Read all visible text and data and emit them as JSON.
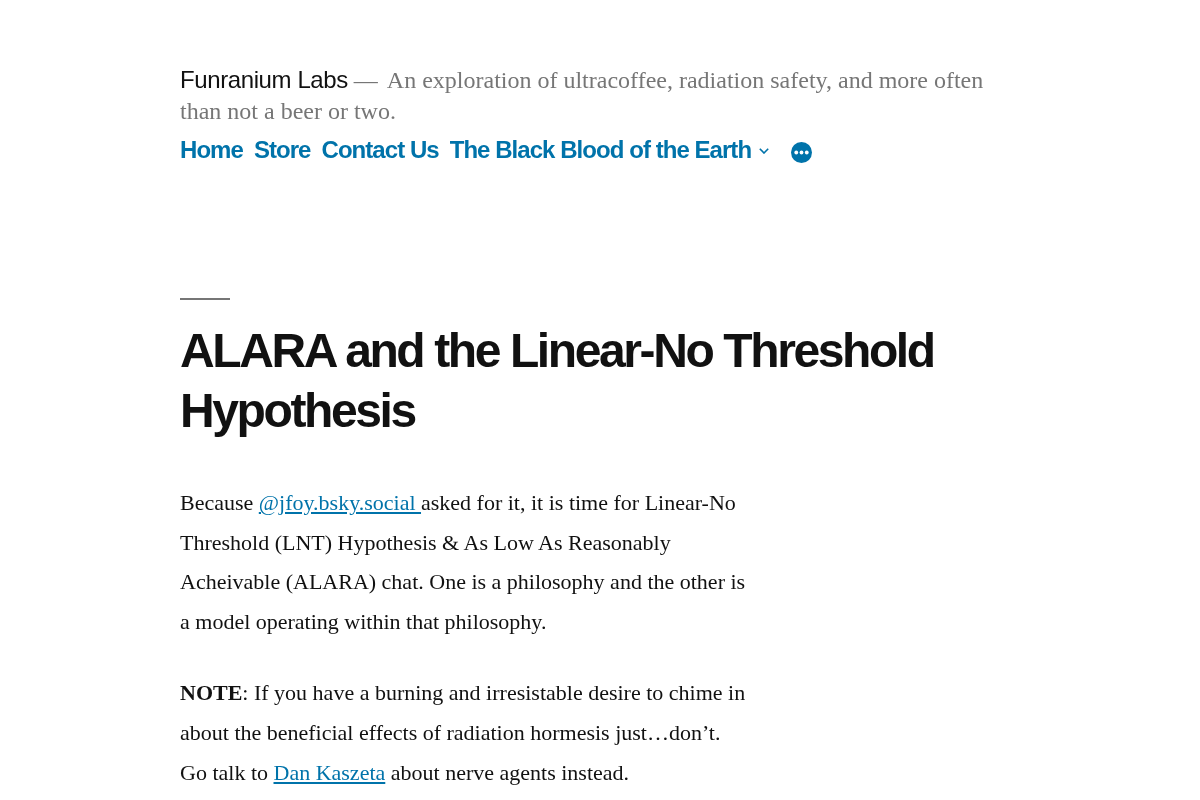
{
  "site": {
    "title": "Funranium Labs",
    "separator": "—",
    "tagline": "An exploration of ultracoffee, radiation safety, and more often than not a beer or two."
  },
  "nav": {
    "items": [
      {
        "label": "Home",
        "has_submenu": false
      },
      {
        "label": "Store",
        "has_submenu": false
      },
      {
        "label": "Contact Us",
        "has_submenu": false
      },
      {
        "label": "The Black Blood of the Earth",
        "has_submenu": true
      }
    ]
  },
  "article": {
    "title": "ALARA and the Linear-No Threshold Hypothesis",
    "paragraphs": [
      [
        {
          "kind": "text",
          "text": "Because "
        },
        {
          "kind": "link",
          "text": "@jfoy.bsky.social "
        },
        {
          "kind": "text",
          "text": "asked for it, it is time for Linear-No Threshold (LNT) Hypothesis & As Low As Reasonably Acheivable (ALARA) chat. One is a philosophy and the other is a model operating within that philosophy."
        }
      ],
      [
        {
          "kind": "text",
          "text": "**NOTE**: If you have a burning and irresistable desire to chime in about the beneficial effects of radiation hormesis just…don’t. Go talk to "
        },
        {
          "kind": "link",
          "text": "Dan Kaszeta"
        },
        {
          "kind": "text",
          "text": " about nerve agents instead."
        }
      ]
    ]
  }
}
